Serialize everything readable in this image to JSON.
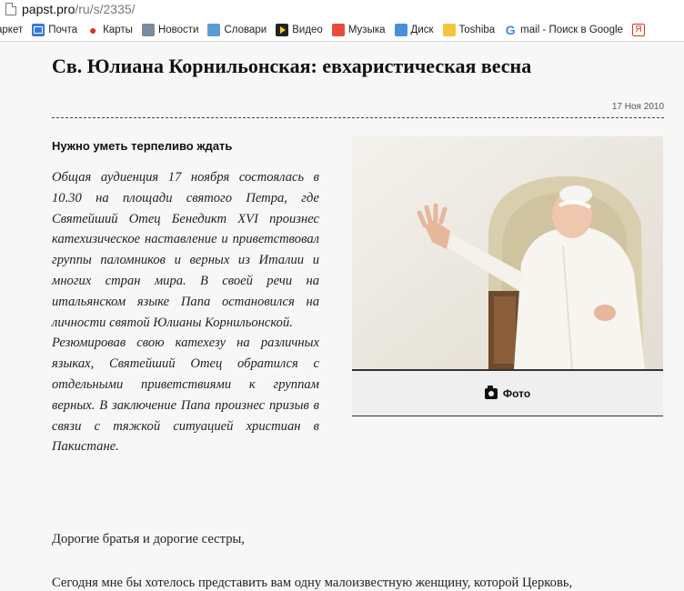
{
  "browser": {
    "url_host": "papst.pro",
    "url_path": "/ru/s/2335/",
    "bookmarks": [
      {
        "label": "аркет",
        "icon": "none"
      },
      {
        "label": "Почта",
        "icon": "mail-icon"
      },
      {
        "label": "Карты",
        "icon": "map-pin-icon"
      },
      {
        "label": "Новости",
        "icon": "news-icon"
      },
      {
        "label": "Словари",
        "icon": "dictionary-icon"
      },
      {
        "label": "Видео",
        "icon": "video-icon"
      },
      {
        "label": "Музыка",
        "icon": "music-icon"
      },
      {
        "label": "Диск",
        "icon": "disk-icon"
      },
      {
        "label": "Toshiba",
        "icon": "folder-icon"
      },
      {
        "label": "mail - Поиск в Google",
        "icon": "google-icon"
      },
      {
        "label": "Я",
        "icon": "yandex-icon"
      }
    ]
  },
  "article": {
    "title": "Св. Юлиана Корнильонская: евхаристическая весна",
    "date": "17 Ноя 2010",
    "subheading": "Нужно уметь терпеливо ждать",
    "lead_p1": "Общая аудиенция 17 ноября состоялась в 10.30 на площади святого Петра, где Святейший Отец Бенедикт XVI произнес катехизическое наставление и приветствовал группы паломников и верных из Италии и многих стран мира. В своей речи на итальянском языке Папа остановился на личности святой Юлианы Корнильонской.",
    "lead_p2": "Резюмировав свою катехезу на различных языках, Святейший Отец обратился с отдельными приветствиями к группам верных. В заключение Папа произнес призыв в связи с тяжкой ситуацией христиан в Пакистане.",
    "photo_caption": "Фото",
    "body_p1": "Дорогие братья и дорогие сестры,",
    "body_p2": "Сегодня мне бы хотелось представить вам одну малоизвестную женщину, которой Церковь,"
  }
}
